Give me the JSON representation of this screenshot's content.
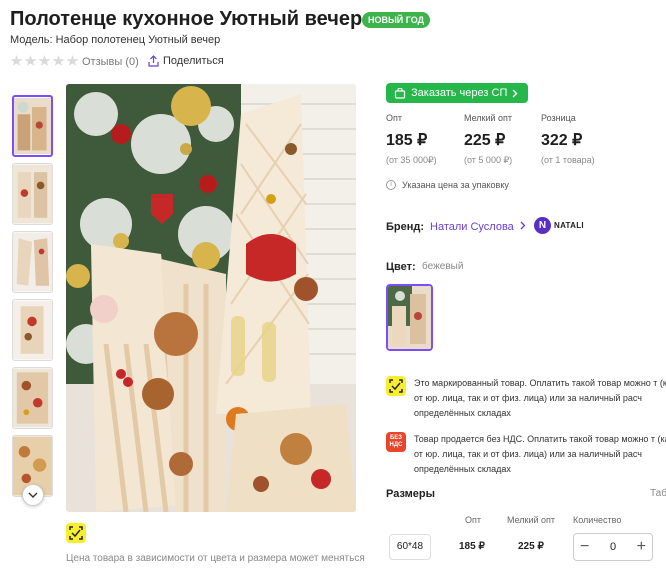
{
  "product": {
    "title": "Полотенце кухонное Уютный вечер",
    "badge": "НОВЫЙ ГОД",
    "model": "Модель: Набор полотенец Уютный вечер",
    "reviews": "Отзывы (0)",
    "share": "Поделиться",
    "rating_stars": 0
  },
  "gallery": {
    "thumbnail_count": 6,
    "selected_index": 0,
    "price_note": "Цена товара в зависимости от цвета и размера может меняться"
  },
  "purchase": {
    "sp_button": "Заказать через СП",
    "prices": [
      {
        "label": "Опт",
        "value": "185 ₽",
        "note": "(от 35 000₽)"
      },
      {
        "label": "Мелкий опт",
        "value": "225 ₽",
        "note": "(от 5 000 ₽)"
      },
      {
        "label": "Розница",
        "value": "322 ₽",
        "note": "(от 1 товара)"
      }
    ],
    "pack_note": "Указана цена за упаковку"
  },
  "brand": {
    "label": "Бренд:",
    "value": "Натали Суслова",
    "logo_text": "NATALI",
    "logo_letter": "N"
  },
  "color": {
    "label": "Цвет:",
    "value": "бежевый"
  },
  "notices": [
    {
      "icon": "marking-icon",
      "text": "Это маркированный товар. Оплатить такой товар можно т (как от юр. лица, так и от физ. лица) или за наличный расч определённых складах"
    },
    {
      "icon": "no-vat-icon",
      "icon_text": "БЕЗ НДС",
      "text": "Товар продается без НДС. Оплатить такой товар можно т (как от юр. лица, так и от физ. лица) или за наличный расч определённых складах"
    }
  ],
  "sizes": {
    "label": "Размеры",
    "table_link": "Таб",
    "headers": {
      "opt": "Опт",
      "small": "Мелкий опт",
      "qty": "Количество"
    },
    "rows": [
      {
        "size": "60*48",
        "opt": "185 ₽",
        "small": "225 ₽",
        "qty": "0"
      }
    ]
  },
  "colors": {
    "accent": "#7c4dff",
    "green": "#25b74a",
    "badge_green": "#3cb44b",
    "brand_purple": "#6b3fd6",
    "marking_yellow": "#f7ef2d",
    "novat_red": "#e8452c"
  }
}
